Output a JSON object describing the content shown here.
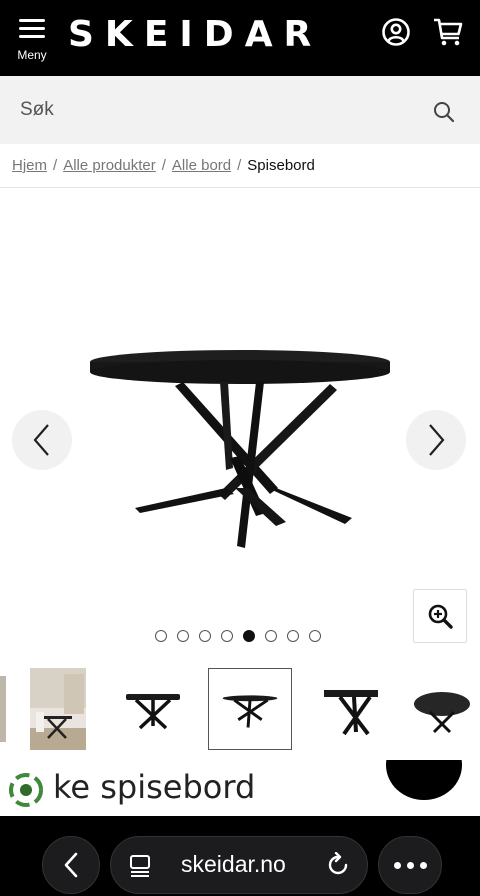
{
  "header": {
    "menu_label": "Meny",
    "logo": "SKEIDAR",
    "account_icon": "account-icon",
    "cart_icon": "cart-icon",
    "background": "#000000"
  },
  "search": {
    "placeholder": "Søk",
    "icon": "search-icon"
  },
  "breadcrumb": {
    "items": [
      "Hjem",
      "Alle produkter",
      "Alle bord"
    ],
    "current": "Spisebord",
    "separator": "/"
  },
  "gallery": {
    "prev_icon": "chevron-left-icon",
    "next_icon": "chevron-right-icon",
    "zoom_icon": "zoom-in-icon",
    "image_count": 8,
    "active_index": 4
  },
  "thumbnails": {
    "count": 6,
    "selected_index": 3
  },
  "product": {
    "title_visible": "ke spisebord",
    "badge_icon": "recycle-badge-icon"
  },
  "browser": {
    "url": "skeidar.no",
    "back_icon": "chevron-left-icon",
    "tabs_icon": "tabs-icon",
    "reload_icon": "reload-icon",
    "more_icon": "more-icon"
  }
}
